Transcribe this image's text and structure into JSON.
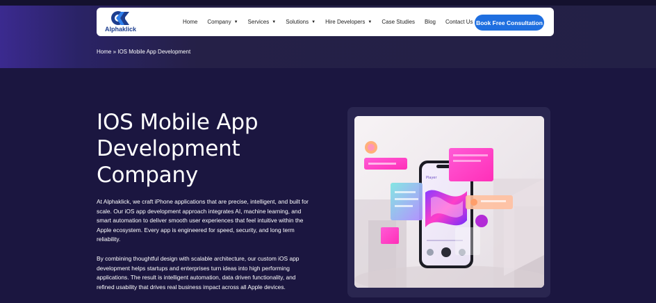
{
  "logo": {
    "text": "Alphaklick"
  },
  "nav": {
    "items": [
      {
        "label": "Home",
        "has_caret": false
      },
      {
        "label": "Company",
        "has_caret": true
      },
      {
        "label": "Services",
        "has_caret": true
      },
      {
        "label": "Solutions",
        "has_caret": true
      },
      {
        "label": "Hire Developers",
        "has_caret": true
      },
      {
        "label": "Case Studies",
        "has_caret": false
      },
      {
        "label": "Blog",
        "has_caret": false
      },
      {
        "label": "Contact Us",
        "has_caret": false
      }
    ],
    "cta_label": "Book Free Consultation"
  },
  "breadcrumb": "Home » IOS Mobile App Development",
  "hero": {
    "title": "IOS Mobile App Development Company",
    "paragraph_1": "At Alphaklick, we craft iPhone applications that are precise, intelligent, and built for scale. Our iOS app development approach integrates AI, machine learning, and smart automation to deliver smooth user experiences that feel intuitive within the Apple ecosystem. Every app is engineered for speed, security, and long term reliability.",
    "paragraph_2": "By combining thoughtful design with scalable architecture, our custom iOS app development helps startups and enterprises turn ideas into high performing applications. The result is intelligent automation, data driven functionality, and refined usability that drives real business impact across all Apple devices."
  },
  "illustration": {
    "phone_screen_label": "Player",
    "colors": {
      "accent": "#1f6fe0",
      "pink": "#ff3ec8",
      "violet": "#8a3cff",
      "teal": "#5fd6d6",
      "peach": "#ffb07a"
    }
  }
}
